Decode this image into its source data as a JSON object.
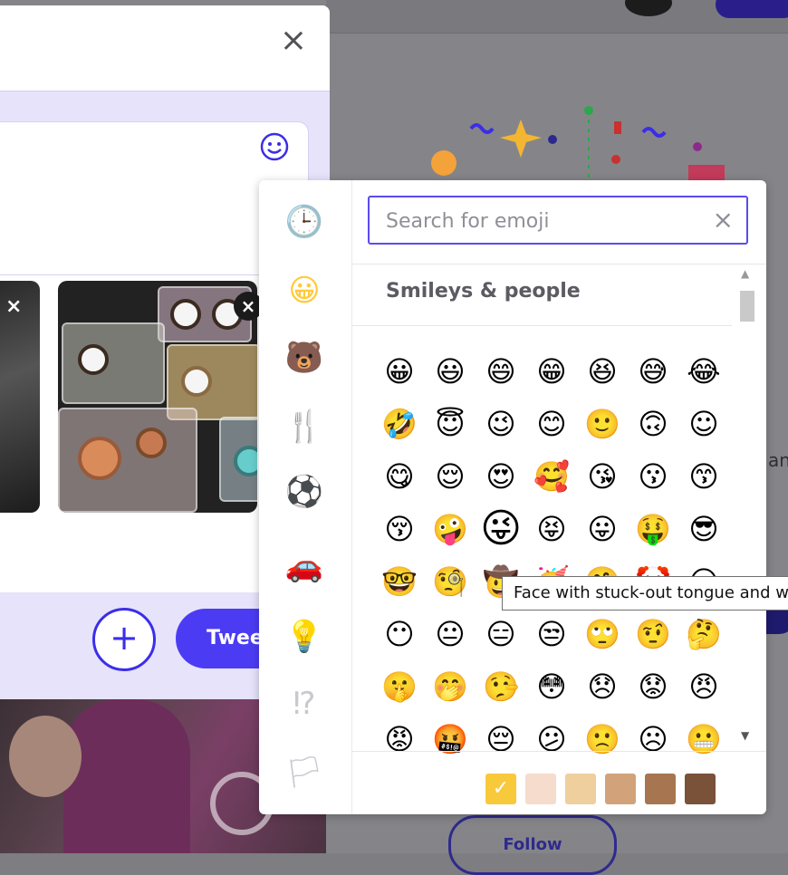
{
  "dialog": {
    "close_icon": "×",
    "add_icon": "+",
    "tweet_label": "Tweet"
  },
  "background": {
    "side_text": "an",
    "follow_label": "Follow"
  },
  "picker": {
    "search_placeholder": "Search for emoji",
    "clear_icon": "×",
    "section_title": "Smileys & people",
    "tooltip": "Face with stuck-out tongue and winking eye",
    "categories": [
      {
        "name": "recent",
        "glyph": "🕒"
      },
      {
        "name": "smileys",
        "glyph": "😀"
      },
      {
        "name": "animals",
        "glyph": "🐻"
      },
      {
        "name": "food",
        "glyph": "🍴"
      },
      {
        "name": "activity",
        "glyph": "⚽"
      },
      {
        "name": "travel",
        "glyph": "🚗"
      },
      {
        "name": "objects",
        "glyph": "💡"
      },
      {
        "name": "symbols",
        "glyph": "⁉"
      },
      {
        "name": "flags",
        "glyph": "🏳"
      }
    ],
    "emoji_rows": [
      [
        "😀",
        "😃",
        "😄",
        "😁",
        "😆",
        "😅",
        "😂"
      ],
      [
        "🤣",
        "😇",
        "😉",
        "😊",
        "🙂",
        "🙃",
        "☺"
      ],
      [
        "😋",
        "😌",
        "😍",
        "🥰",
        "😘",
        "😗",
        "😙"
      ],
      [
        "😚",
        "🤪",
        "😜",
        "😝",
        "😛",
        "🤑",
        "😎"
      ],
      [
        "🤓",
        "🧐",
        "🤠",
        "🥳",
        "🤗",
        "🤡",
        "😏"
      ],
      [
        "😶",
        "😐",
        "😑",
        "😒",
        "🙄",
        "🤨",
        "🤔"
      ],
      [
        "🤫",
        "🤭",
        "🤥",
        "😳",
        "😞",
        "😟",
        "😠"
      ],
      [
        "😡",
        "🤬",
        "😔",
        "😕",
        "🙁",
        "☹",
        "😬"
      ]
    ],
    "skin_tones": [
      "#f9c93c",
      "#f6dccd",
      "#efcf9e",
      "#d2a37a",
      "#a77550",
      "#7a5139"
    ],
    "accent": "#5a4bef"
  }
}
